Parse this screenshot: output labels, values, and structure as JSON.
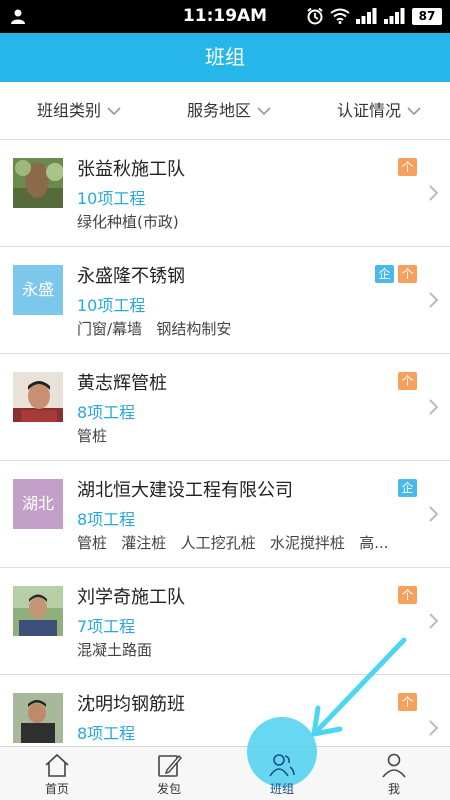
{
  "status_bar": {
    "time": "11:19AM",
    "battery": "87"
  },
  "header": {
    "title": "班组"
  },
  "filters": [
    {
      "label": "班组类别"
    },
    {
      "label": "服务地区"
    },
    {
      "label": "认证情况"
    }
  ],
  "teams": [
    {
      "name": "张益秋施工队",
      "count": "10项工程",
      "tags": "绿化种植(市政)",
      "badges": [
        "个"
      ],
      "avatar_text": ""
    },
    {
      "name": "永盛隆不锈钢",
      "count": "10项工程",
      "tags": "门窗/幕墙   钢结构制安",
      "badges": [
        "企",
        "个"
      ],
      "avatar_text": "永盛"
    },
    {
      "name": "黄志辉管桩",
      "count": "8项工程",
      "tags": "管桩",
      "badges": [
        "个"
      ],
      "avatar_text": ""
    },
    {
      "name": "湖北恒大建设工程有限公司",
      "count": "8项工程",
      "tags": "管桩   灌注桩   人工挖孔桩   水泥搅拌桩   高...",
      "badges": [
        "企"
      ],
      "avatar_text": "湖北"
    },
    {
      "name": "刘学奇施工队",
      "count": "7项工程",
      "tags": "混凝土路面",
      "badges": [
        "个"
      ],
      "avatar_text": ""
    },
    {
      "name": "沈明均钢筋班",
      "count": "8项工程",
      "tags": "",
      "badges": [
        "个"
      ],
      "avatar_text": ""
    }
  ],
  "tab_bar": {
    "tabs": [
      {
        "label": "首页",
        "icon": "home-icon"
      },
      {
        "label": "发包",
        "icon": "edit-icon"
      },
      {
        "label": "班组",
        "icon": "group-icon",
        "active": true
      },
      {
        "label": "我",
        "icon": "person-icon"
      }
    ]
  },
  "colors": {
    "accent": "#27b6ea",
    "count_text": "#27a9d8",
    "badge_person": "#f5a05c",
    "badge_company": "#4ab8e8",
    "avatar_yongsheng": "#7cc8ec",
    "avatar_hubei": "#c2a0c8",
    "arrow": "#4dd6f2"
  }
}
